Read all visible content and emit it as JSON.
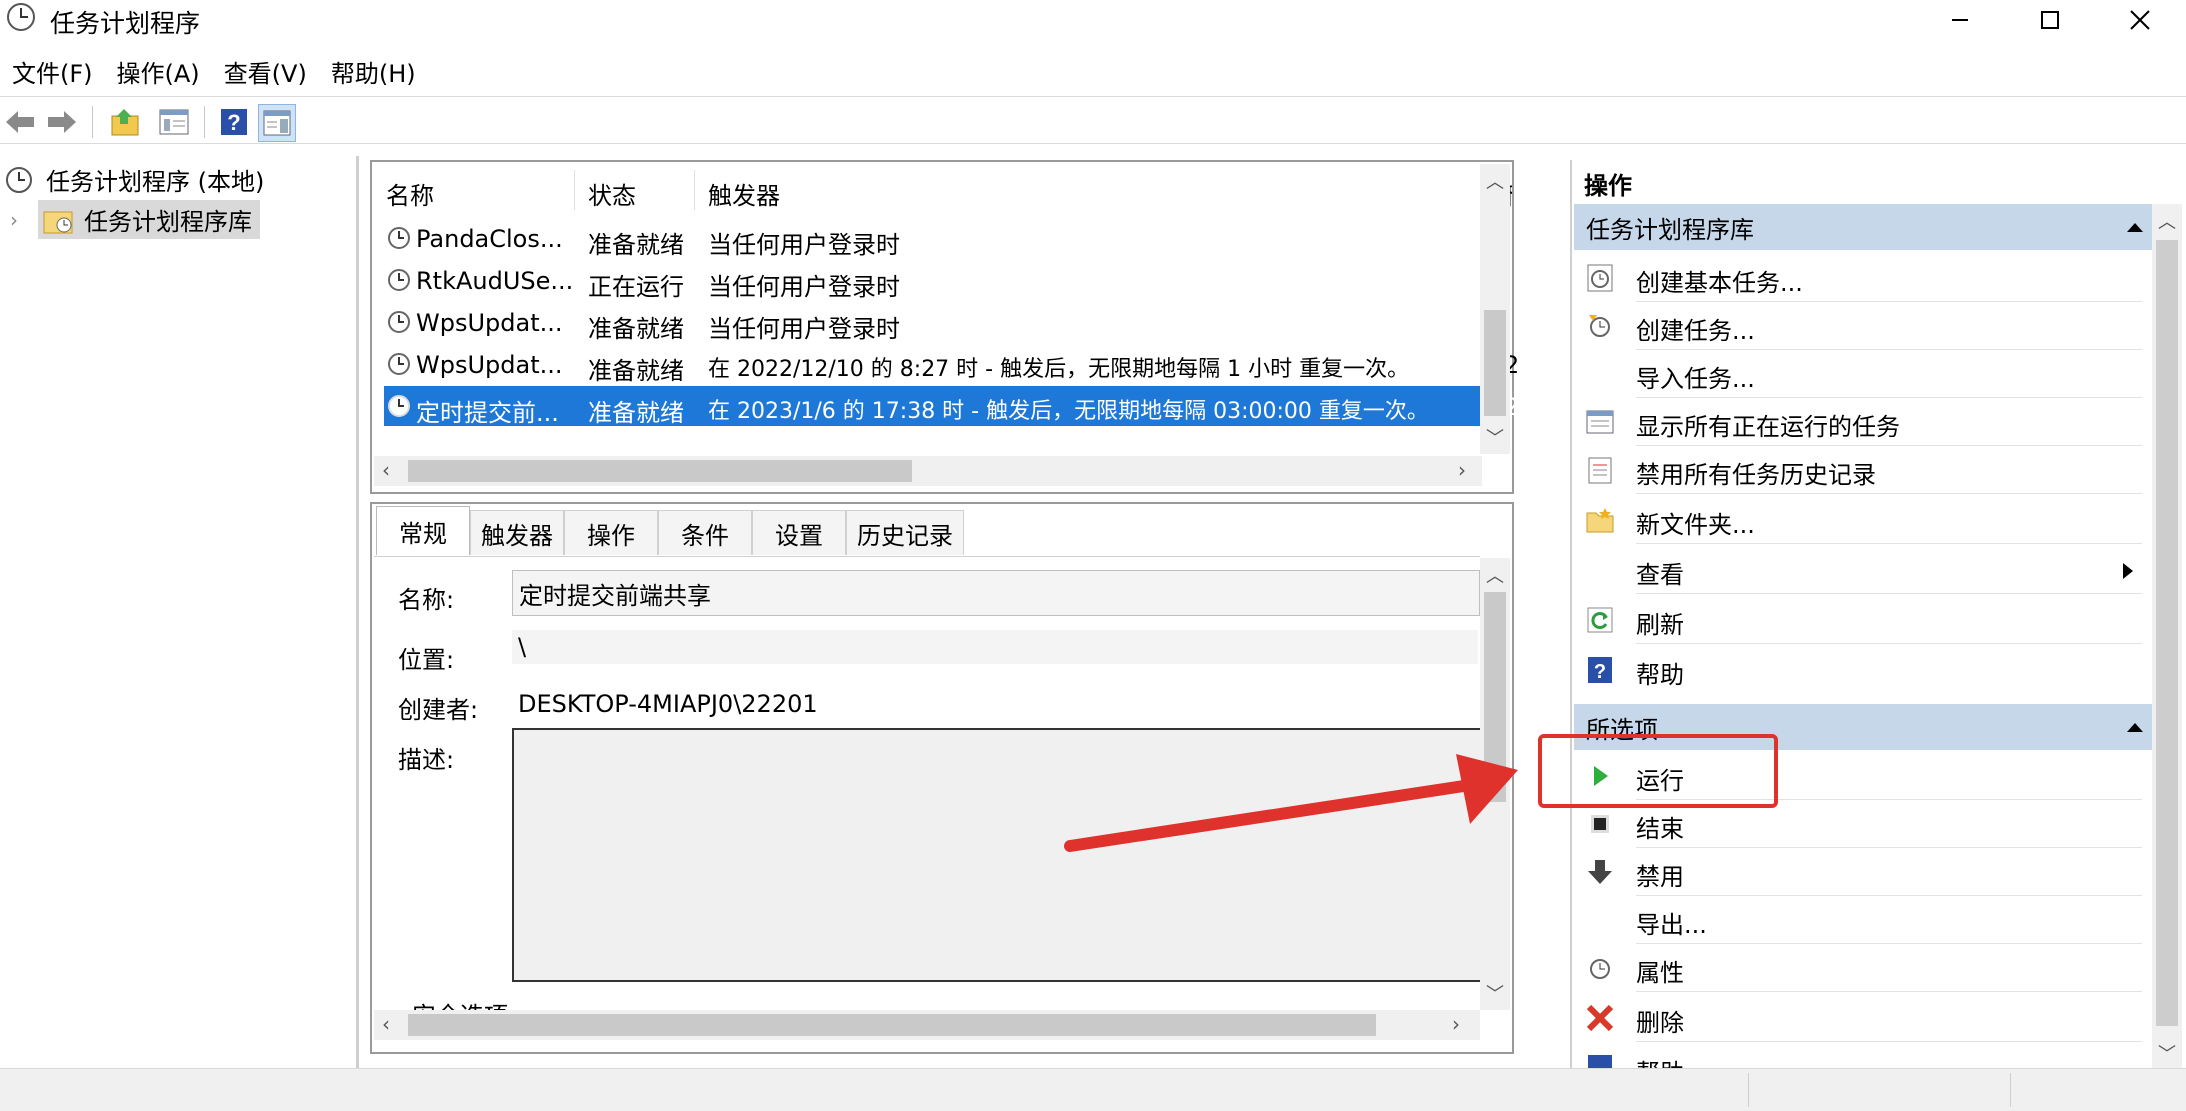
{
  "window": {
    "title": "任务计划程序",
    "controls": {
      "minimize": "—",
      "maximize": "☐",
      "close": "✕"
    }
  },
  "menu": [
    "文件(F)",
    "操作(A)",
    "查看(V)",
    "帮助(H)"
  ],
  "tree": {
    "root": "任务计划程序 (本地)",
    "child": "任务计划程序库"
  },
  "task_list": {
    "columns": [
      "名称",
      "状态",
      "触发器",
      "下"
    ],
    "rows": [
      {
        "name": "PandaClos...",
        "status": "准备就绪",
        "trigger": "当任何用户登录时",
        "next": ""
      },
      {
        "name": "RtkAudUSe...",
        "status": "正在运行",
        "trigger": "当任何用户登录时",
        "next": ""
      },
      {
        "name": "WpsUpdat...",
        "status": "准备就绪",
        "trigger": "当任何用户登录时",
        "next": ""
      },
      {
        "name": "WpsUpdat...",
        "status": "准备就绪",
        "trigger": "在 2022/12/10 的 8:27 时 - 触发后，无限期地每隔 1 小时 重复一次。",
        "next": "2"
      },
      {
        "name": "定时提交前...",
        "status": "准备就绪",
        "trigger": "在 2023/1/6 的 17:38 时 - 触发后，无限期地每隔 03:00:00 重复一次。",
        "next": "2",
        "selected": true
      }
    ]
  },
  "details": {
    "tabs": [
      "常规",
      "触发器",
      "操作",
      "条件",
      "设置",
      "历史记录"
    ],
    "active_tab": "常规",
    "name_label": "名称:",
    "name_value": "定时提交前端共享",
    "location_label": "位置:",
    "location_value": "\\",
    "author_label": "创建者:",
    "author_value": "DESKTOP-4MIAPJ0\\22201",
    "description_label": "描述:",
    "description_value": "",
    "security_label": "安全选项"
  },
  "actions_panel": {
    "header": "操作",
    "section1": "任务计划程序库",
    "section1_items": [
      {
        "label": "创建基本任务...",
        "icon": "create-basic-task-icon"
      },
      {
        "label": "创建任务...",
        "icon": "create-task-icon"
      },
      {
        "label": "导入任务...",
        "icon": ""
      },
      {
        "label": "显示所有正在运行的任务",
        "icon": "running-tasks-icon"
      },
      {
        "label": "禁用所有任务历史记录",
        "icon": "history-icon"
      },
      {
        "label": "新文件夹...",
        "icon": "folder-icon"
      },
      {
        "label": "查看",
        "icon": ""
      },
      {
        "label": "刷新",
        "icon": "refresh-icon"
      },
      {
        "label": "帮助",
        "icon": "help-icon"
      }
    ],
    "section2": "所选项",
    "section2_items": [
      {
        "label": "运行",
        "icon": "run-icon"
      },
      {
        "label": "结束",
        "icon": "stop-icon"
      },
      {
        "label": "禁用",
        "icon": "disable-icon"
      },
      {
        "label": "导出...",
        "icon": ""
      },
      {
        "label": "属性",
        "icon": "properties-icon"
      },
      {
        "label": "删除",
        "icon": "delete-icon"
      },
      {
        "label": "帮助",
        "icon": "help-icon"
      }
    ]
  },
  "colors": {
    "selection": "#1e78d7",
    "section_header": "#c6d7ea",
    "annotation_red": "#e0322c"
  }
}
